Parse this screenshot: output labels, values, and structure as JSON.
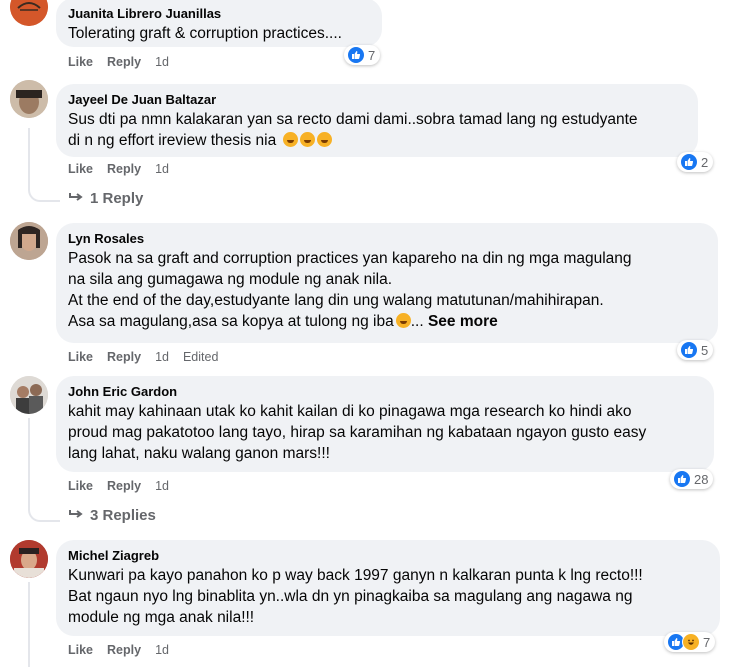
{
  "comments": [
    {
      "author": "Juanita Librero Juanillas",
      "text": "Tolerating graft & corruption practices....",
      "like": "Like",
      "reply": "Reply",
      "time": "1d",
      "reaction_count": "7"
    },
    {
      "author": "Jayeel De Juan Baltazar",
      "text": "Sus dti pa nmn kalakaran yan sa recto dami dami..sobra tamad lang ng estudyante\ndi n ng effort ireview thesis nia",
      "like": "Like",
      "reply": "Reply",
      "time": "1d",
      "reaction_count": "2",
      "replies": "1 Reply"
    },
    {
      "author": "Lyn Rosales",
      "text": "Pasok na sa graft and corruption practices yan kapareho na din ng mga magulang\nna sila ang gumagawa ng module ng anak nila.\nAt the end of the day,estudyante lang din ung walang matutunan/mahihirapan.\nAsa sa magulang,asa sa kopya at tulong ng iba",
      "see_more": "See more",
      "like": "Like",
      "reply": "Reply",
      "time": "1d",
      "edited": "Edited",
      "reaction_count": "5"
    },
    {
      "author": "John Eric Gardon",
      "text": "kahit may kahinaan utak ko kahit kailan di ko pinagawa mga research ko hindi ako\nproud mag pakatotoo lang tayo, hirap sa karamihan ng kabataan ngayon gusto easy\nlang lahat, naku walang ganon mars!!!",
      "like": "Like",
      "reply": "Reply",
      "time": "1d",
      "reaction_count": "28",
      "replies": "3 Replies"
    },
    {
      "author": "Michel Ziagreb",
      "text": "Kunwari pa kayo panahon ko p way back 1997 ganyn n kalkaran punta k lng recto!!!\nBat ngaun nyo lng binablita yn..wla dn yn pinagkaiba sa magulang ang nagawa ng\nmodule ng mga anak nila!!!",
      "like": "Like",
      "reply": "Reply",
      "time": "1d",
      "reaction_count": "7"
    }
  ],
  "colors": {
    "like": "#1877f2",
    "haha": "#f7b125",
    "bubble": "#f0f2f5",
    "meta": "#65676b"
  },
  "icons": {
    "like": "thumbs-up-icon",
    "haha": "haha-icon",
    "reply_arrow": "reply-arrow-icon"
  }
}
